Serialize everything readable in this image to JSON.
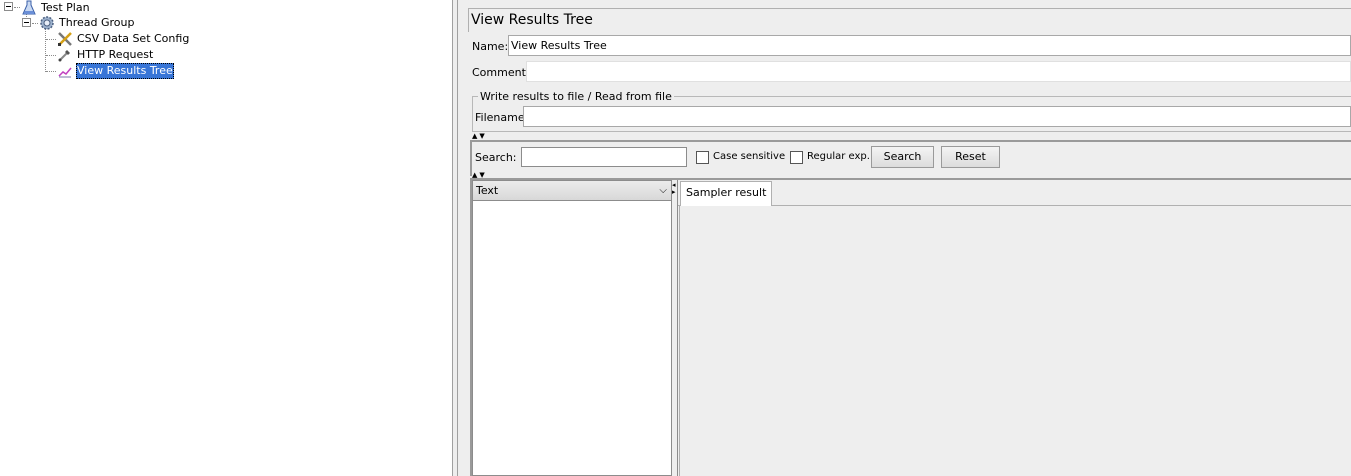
{
  "tree": {
    "nodes": [
      {
        "label": "Test Plan",
        "icon": "flask-icon"
      },
      {
        "label": "Thread Group",
        "icon": "gear-icon"
      },
      {
        "label": "CSV Data Set Config",
        "icon": "wrench-screwdriver-icon"
      },
      {
        "label": "HTTP Request",
        "icon": "pipette-icon"
      },
      {
        "label": "View Results Tree",
        "icon": "listener-chart-icon",
        "selected": true
      }
    ]
  },
  "panel": {
    "title": "View Results Tree",
    "name_label": "Name:",
    "name_value": "View Results Tree",
    "comments_label": "Comments:",
    "comments_value": "",
    "file_group_title": "Write results to file / Read from file",
    "filename_label": "Filename",
    "filename_value": ""
  },
  "search": {
    "label": "Search:",
    "value": "",
    "case_sensitive_label": "Case sensitive",
    "case_sensitive_checked": false,
    "regular_exp_label": "Regular exp.",
    "regular_exp_checked": false,
    "search_button": "Search",
    "reset_button": "Reset"
  },
  "results": {
    "renderer_selected": "Text",
    "tabs": [
      "Sampler result"
    ]
  }
}
